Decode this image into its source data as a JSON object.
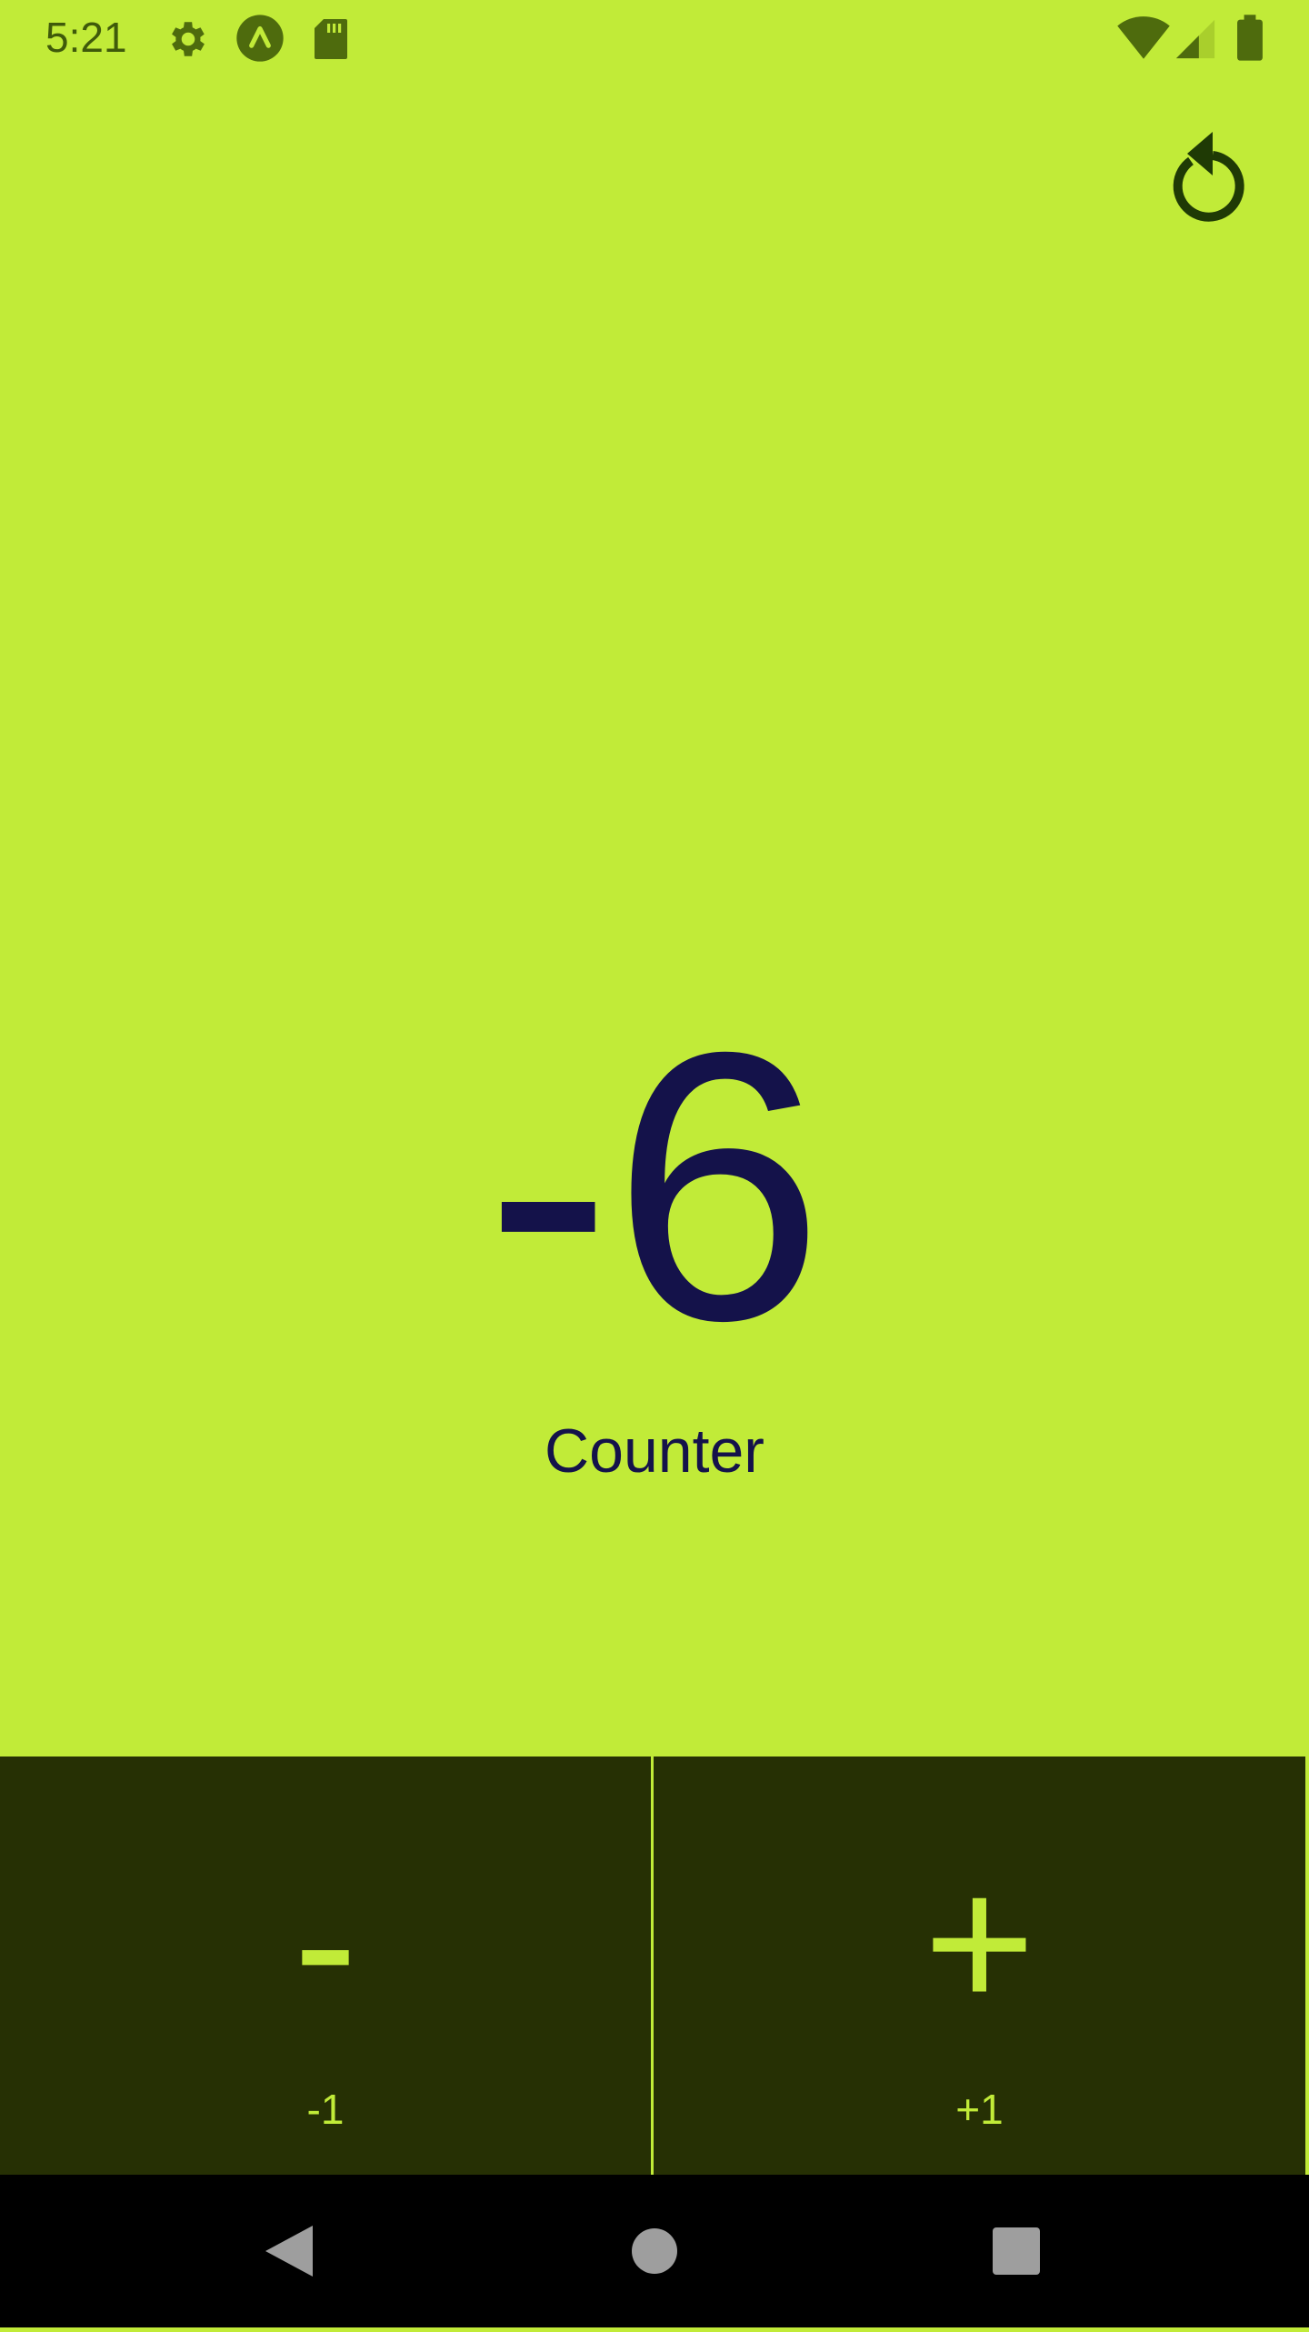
{
  "status_bar": {
    "time": "5:21",
    "left_icons": [
      "settings-icon",
      "app-notification-icon",
      "sd-card-icon"
    ],
    "right_icons": [
      "wifi-icon",
      "cell-signal-icon",
      "battery-icon"
    ]
  },
  "app": {
    "reset_icon": "reset-icon",
    "counter_value": "-6",
    "counter_label": "Counter",
    "decrement": {
      "symbol": "-",
      "label": "-1"
    },
    "increment": {
      "symbol": "+",
      "label": "+1"
    }
  },
  "nav_bar": {
    "icons": [
      "back-icon",
      "home-icon",
      "recents-icon"
    ]
  },
  "colors": {
    "background": "#c1eb38",
    "counter_text": "#14124a",
    "button_background": "#263004",
    "button_text": "#c1eb38",
    "nav_background": "#000000"
  }
}
